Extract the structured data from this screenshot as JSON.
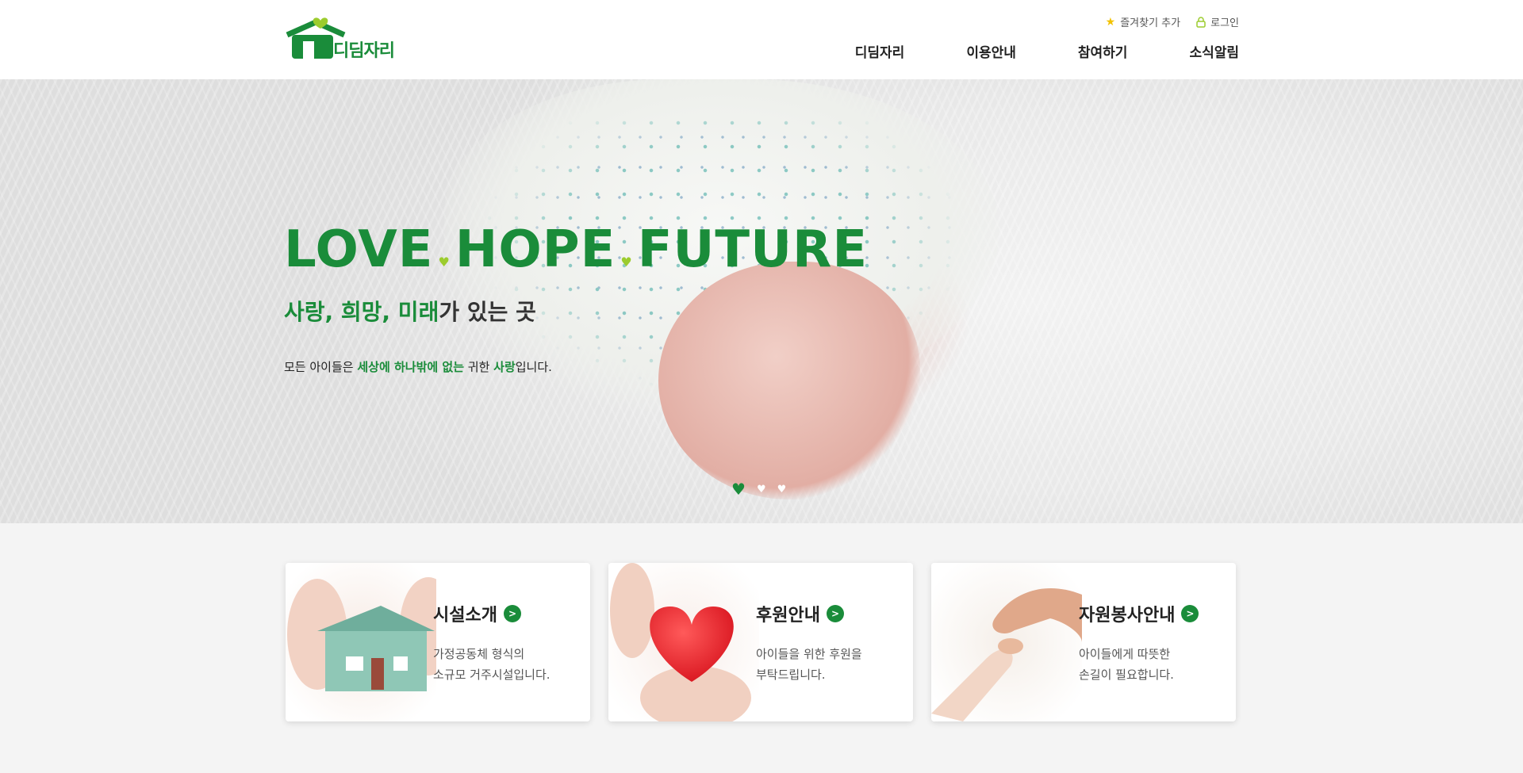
{
  "header": {
    "logo_text": "디딤자리",
    "util": {
      "bookmark": "즐겨찾기 추가",
      "login": "로그인"
    },
    "nav": [
      "디딤자리",
      "이용안내",
      "참여하기",
      "소식알림"
    ]
  },
  "hero": {
    "title_words": [
      "LOVE",
      "HOPE",
      "FUTURE"
    ],
    "subtitle": {
      "green": "사랑, 희망, 미래",
      "rest": "가 있는 곳"
    },
    "desc": {
      "a": "모든 아이들은 ",
      "b": "세상에 하나밖에 없는",
      "c": " 귀한 ",
      "d": "사랑",
      "e": "입니다."
    },
    "slides_total": 3,
    "slide_active": 1
  },
  "cards": [
    {
      "title": "시설소개",
      "line1": "가정공동체 형식의",
      "line2": "소규모 거주시설입니다."
    },
    {
      "title": "후원안내",
      "line1": "아이들을 위한 후원을",
      "line2": "부탁드립니다."
    },
    {
      "title": "자원봉사안내",
      "line1": "아이들에게 따뜻한",
      "line2": "손길이 필요합니다."
    }
  ],
  "colors": {
    "brand_green": "#1a8c3a",
    "accent_lime": "#9ccc2e",
    "star_yellow": "#f2c200"
  }
}
